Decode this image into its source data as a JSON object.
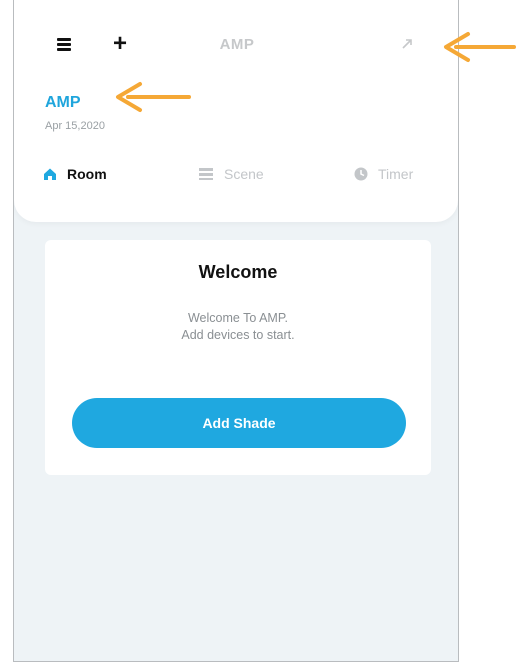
{
  "app": {
    "title": "AMP"
  },
  "home": {
    "name": "AMP",
    "date": "Apr 15,2020"
  },
  "tabs": [
    {
      "label": "Room",
      "icon": "home-icon",
      "active": true
    },
    {
      "label": "Scene",
      "icon": "scene-icon",
      "active": false
    },
    {
      "label": "Timer",
      "icon": "clock-icon",
      "active": false
    }
  ],
  "welcome": {
    "title": "Welcome",
    "line1": "Welcome To AMP.",
    "line2": "Add devices to start.",
    "add_button": "Add Shade"
  },
  "colors": {
    "accent": "#1fa8e0",
    "annotation_arrow": "#f5a836",
    "background": "#eef3f6"
  }
}
